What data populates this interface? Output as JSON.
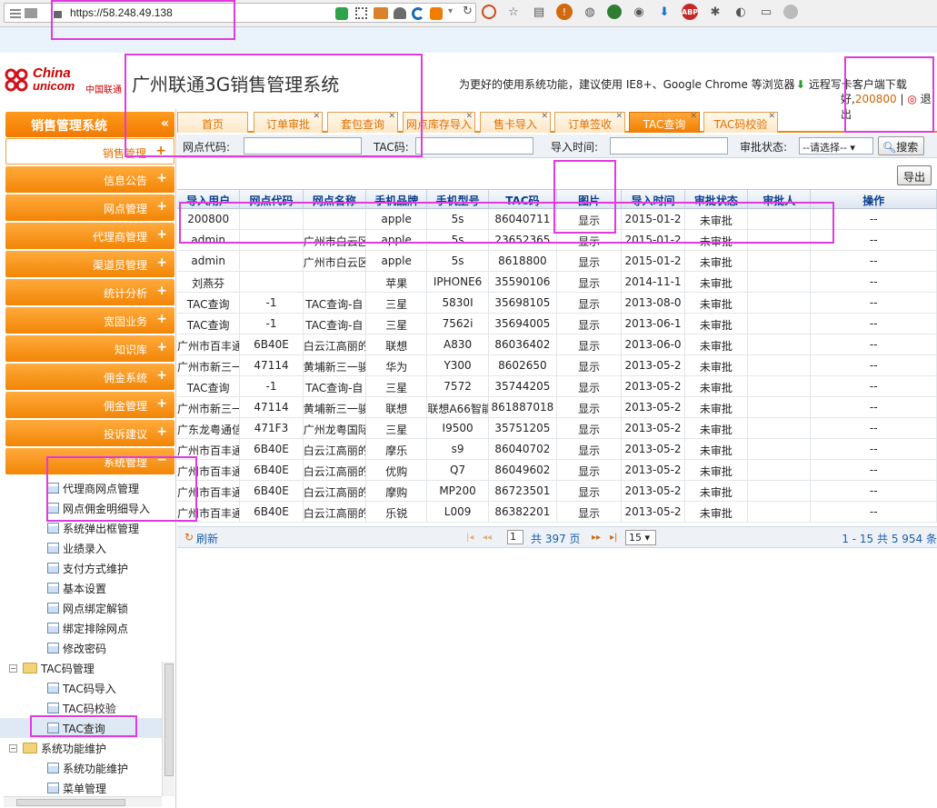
{
  "browser": {
    "url": "https://58.248.49.138"
  },
  "header": {
    "logo_line1": "China",
    "logo_line2": "unicom",
    "logo_cn": "中国联通",
    "system_title": "广州联通3G销售管理系统",
    "notice": "为更好的使用系统功能，建议使用 IE8+、Google Chrome 等浏览器",
    "download": "远程写卡客户端下载",
    "greeting_suffix": "好,",
    "user_id": "200800",
    "logout": "退出"
  },
  "sidebar": {
    "title": "销售管理系统",
    "menu": [
      "销售管理",
      "信息公告",
      "网点管理",
      "代理商管理",
      "渠道员管理",
      "统计分析",
      "宽固业务",
      "知识库",
      "佣金系统",
      "佣金管理",
      "投诉建议",
      "系统管理"
    ],
    "tree": [
      {
        "label": "代理商网点管理",
        "kind": "page",
        "level": 2
      },
      {
        "label": "网点佣金明细导入",
        "kind": "page",
        "level": 2
      },
      {
        "label": "系统弹出框管理",
        "kind": "page",
        "level": 2
      },
      {
        "label": "业绩录入",
        "kind": "page",
        "level": 2
      },
      {
        "label": "支付方式维护",
        "kind": "page",
        "level": 2
      },
      {
        "label": "基本设置",
        "kind": "page",
        "level": 2
      },
      {
        "label": "网点绑定解锁",
        "kind": "page",
        "level": 2
      },
      {
        "label": "绑定排除网点",
        "kind": "page",
        "level": 2
      },
      {
        "label": "修改密码",
        "kind": "page",
        "level": 2
      },
      {
        "label": "TAC码管理",
        "kind": "folder",
        "level": 1
      },
      {
        "label": "TAC码导入",
        "kind": "page",
        "level": 2
      },
      {
        "label": "TAC码校验",
        "kind": "page",
        "level": 2
      },
      {
        "label": "TAC查询",
        "kind": "page",
        "level": 2,
        "selected": true
      },
      {
        "label": "系统功能维护",
        "kind": "folder",
        "level": 1
      },
      {
        "label": "系统功能维护",
        "kind": "page",
        "level": 2
      },
      {
        "label": "菜单管理",
        "kind": "page",
        "level": 2
      }
    ]
  },
  "tabs": [
    {
      "label": "首页",
      "closable": false
    },
    {
      "label": "订单审批",
      "closable": true
    },
    {
      "label": "套包查询",
      "closable": true
    },
    {
      "label": "网点库存导入",
      "closable": true
    },
    {
      "label": "售卡导入",
      "closable": true
    },
    {
      "label": "订单签收",
      "closable": true
    },
    {
      "label": "TAC查询",
      "closable": true,
      "active": true
    },
    {
      "label": "TAC码校验",
      "closable": true
    }
  ],
  "search": {
    "outlet_code_label": "网点代码:",
    "tac_label": "TAC码:",
    "import_time_label": "导入时间:",
    "status_label": "审批状态:",
    "status_value": "--请选择--",
    "search_button": "搜索"
  },
  "toolbar": {
    "export": "导出"
  },
  "table": {
    "columns": [
      "导入用户",
      "网点代码",
      "网点名称",
      "手机品牌",
      "手机型号",
      "TAC码",
      "图片",
      "导入时间",
      "审批状态",
      "审批人",
      "操作"
    ],
    "rows": [
      [
        "200800",
        "",
        "",
        "apple",
        "5s",
        "86040711",
        "显示",
        "2015-01-2",
        "未审批",
        "",
        "--"
      ],
      [
        "admin",
        "",
        "广州市白云区",
        "apple",
        "5s",
        "23652365",
        "显示",
        "2015-01-2",
        "未审批",
        "",
        "--"
      ],
      [
        "admin",
        "",
        "广州市白云区",
        "apple",
        "5s",
        "8618800",
        "显示",
        "2015-01-2",
        "未审批",
        "",
        "--"
      ],
      [
        "刘燕芬",
        "",
        "",
        "苹果",
        "IPHONE6",
        "35590106",
        "显示",
        "2014-11-1",
        "未审批",
        "",
        "--"
      ],
      [
        "TAC查询",
        "-1",
        "TAC查询-自",
        "三星",
        "5830I",
        "35698105",
        "显示",
        "2013-08-0",
        "未审批",
        "",
        "--"
      ],
      [
        "TAC查询",
        "-1",
        "TAC查询-自",
        "三星",
        "7562i",
        "35694005",
        "显示",
        "2013-06-1",
        "未审批",
        "",
        "--"
      ],
      [
        "广州市百丰通",
        "6B40E",
        "白云江高丽的",
        "联想",
        "A830",
        "86036402",
        "显示",
        "2013-06-0",
        "未审批",
        "",
        "--"
      ],
      [
        "广州市新三一",
        "47114",
        "黄埔新三一骏",
        "华为",
        "Y300",
        "8602650",
        "显示",
        "2013-05-2",
        "未审批",
        "",
        "--"
      ],
      [
        "TAC查询",
        "-1",
        "TAC查询-自",
        "三星",
        "7572",
        "35744205",
        "显示",
        "2013-05-2",
        "未审批",
        "",
        "--"
      ],
      [
        "广州市新三一",
        "47114",
        "黄埔新三一骏",
        "联想",
        "联想A66智能",
        "861887018",
        "显示",
        "2013-05-2",
        "未审批",
        "",
        "--"
      ],
      [
        "广东龙粤通信",
        "471F3",
        "广州龙粤国际",
        "三星",
        "I9500",
        "35751205",
        "显示",
        "2013-05-2",
        "未审批",
        "",
        "--"
      ],
      [
        "广州市百丰通",
        "6B40E",
        "白云江高丽的",
        "摩乐",
        "s9",
        "86040702",
        "显示",
        "2013-05-2",
        "未审批",
        "",
        "--"
      ],
      [
        "广州市百丰通",
        "6B40E",
        "白云江高丽的",
        "优购",
        "Q7",
        "86049602",
        "显示",
        "2013-05-2",
        "未审批",
        "",
        "--"
      ],
      [
        "广州市百丰通",
        "6B40E",
        "白云江高丽的",
        "摩购",
        "MP200",
        "86723501",
        "显示",
        "2013-05-2",
        "未审批",
        "",
        "--"
      ],
      [
        "广州市百丰通",
        "6B40E",
        "白云江高丽的",
        "乐锐",
        "L009",
        "86382201",
        "显示",
        "2013-05-2",
        "未审批",
        "",
        "--"
      ]
    ]
  },
  "pager": {
    "refresh": "刷新",
    "page_input": "1",
    "total_pages": "共 397 页",
    "page_size": "15",
    "summary": "1 - 15  共 5 954 条"
  }
}
